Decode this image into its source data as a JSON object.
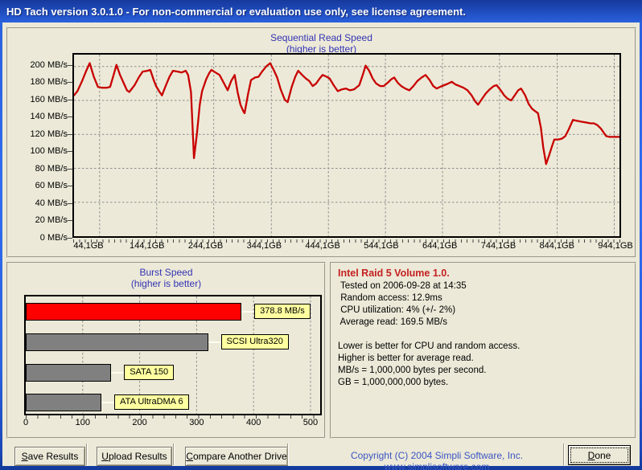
{
  "window": {
    "title": "HD Tach version 3.0.1.0  - For non-commercial or evaluation use only, see license agreement."
  },
  "colors": {
    "window_frame_blue": "#2a62e0",
    "client_beige": "#ece9d8",
    "chart_title_blue": "#3333b3",
    "seq_line_red": "#c80000",
    "burst_bar_red": "#ff0000",
    "burst_bar_gray": "#808080",
    "label_box_yellow": "#ffffa0",
    "drive_name_red": "#c42020",
    "copyright_blue": "#3b55c4"
  },
  "chart_data": [
    {
      "type": "line",
      "title": "Sequential Read Speed",
      "subtitle": "(higher is better)",
      "legend": "read speed (MB/s) vs position (GB)",
      "x_range": [
        14,
        951
      ],
      "y_range": [
        0,
        214
      ],
      "x_ticks": [
        {
          "gb": 44.1,
          "label": "44,1GB"
        },
        {
          "gb": 144.1,
          "label": "144,1GB"
        },
        {
          "gb": 244.1,
          "label": "244,1GB"
        },
        {
          "gb": 344.1,
          "label": "344,1GB"
        },
        {
          "gb": 444.1,
          "label": "444,1GB"
        },
        {
          "gb": 544.1,
          "label": "544,1GB"
        },
        {
          "gb": 644.1,
          "label": "644,1GB"
        },
        {
          "gb": 744.1,
          "label": "744,1GB"
        },
        {
          "gb": 844.1,
          "label": "844,1GB"
        },
        {
          "gb": 944.1,
          "label": "944,1GB"
        }
      ],
      "y_ticks": [
        {
          "v": 200,
          "label": "200 MB/s"
        },
        {
          "v": 180,
          "label": "180 MB/s"
        },
        {
          "v": 160,
          "label": "160 MB/s"
        },
        {
          "v": 140,
          "label": "140 MB/s"
        },
        {
          "v": 120,
          "label": "120 MB/s"
        },
        {
          "v": 100,
          "label": "100 MB/s"
        },
        {
          "v": 80,
          "label": "80 MB/s"
        },
        {
          "v": 60,
          "label": "60 MB/s"
        },
        {
          "v": 40,
          "label": "40 MB/s"
        },
        {
          "v": 20,
          "label": "20 MB/s"
        },
        {
          "v": 0,
          "label": "0 MB/s"
        }
      ],
      "h_gridlines": [
        40,
        80,
        120,
        160,
        200
      ],
      "v_gridlines": [
        58,
        156,
        254,
        353,
        451,
        549,
        647,
        745,
        844,
        942
      ],
      "line_color": "#c80000",
      "points": [
        [
          14,
          166
        ],
        [
          20,
          171
        ],
        [
          28,
          183
        ],
        [
          35,
          195
        ],
        [
          41,
          204
        ],
        [
          48,
          188
        ],
        [
          55,
          176
        ],
        [
          62,
          175
        ],
        [
          70,
          175
        ],
        [
          76,
          176
        ],
        [
          82,
          190
        ],
        [
          87,
          202
        ],
        [
          93,
          190
        ],
        [
          99,
          181
        ],
        [
          105,
          172
        ],
        [
          109,
          170
        ],
        [
          118,
          178
        ],
        [
          126,
          188
        ],
        [
          132,
          194
        ],
        [
          140,
          195
        ],
        [
          145,
          196
        ],
        [
          151,
          184
        ],
        [
          155,
          177
        ],
        [
          161,
          170
        ],
        [
          165,
          166
        ],
        [
          172,
          178
        ],
        [
          178,
          188
        ],
        [
          184,
          195
        ],
        [
          192,
          194
        ],
        [
          199,
          193
        ],
        [
          206,
          195
        ],
        [
          210,
          190
        ],
        [
          215,
          170
        ],
        [
          220,
          92
        ],
        [
          225,
          120
        ],
        [
          230,
          155
        ],
        [
          234,
          171
        ],
        [
          241,
          185
        ],
        [
          246,
          192
        ],
        [
          250,
          196
        ],
        [
          257,
          193
        ],
        [
          264,
          190
        ],
        [
          271,
          181
        ],
        [
          278,
          172
        ],
        [
          284,
          183
        ],
        [
          290,
          190
        ],
        [
          295,
          170
        ],
        [
          300,
          155
        ],
        [
          305,
          147
        ],
        [
          307,
          145
        ],
        [
          313,
          168
        ],
        [
          318,
          184
        ],
        [
          325,
          187
        ],
        [
          331,
          188
        ],
        [
          337,
          194
        ],
        [
          344,
          200
        ],
        [
          351,
          204
        ],
        [
          357,
          196
        ],
        [
          363,
          187
        ],
        [
          369,
          173
        ],
        [
          376,
          161
        ],
        [
          381,
          158
        ],
        [
          388,
          176
        ],
        [
          394,
          188
        ],
        [
          399,
          195
        ],
        [
          406,
          190
        ],
        [
          412,
          186
        ],
        [
          418,
          183
        ],
        [
          424,
          177
        ],
        [
          430,
          180
        ],
        [
          436,
          186
        ],
        [
          441,
          190
        ],
        [
          448,
          188
        ],
        [
          453,
          186
        ],
        [
          460,
          178
        ],
        [
          467,
          171
        ],
        [
          474,
          173
        ],
        [
          481,
          174
        ],
        [
          488,
          172
        ],
        [
          495,
          173
        ],
        [
          504,
          178
        ],
        [
          510,
          190
        ],
        [
          515,
          201
        ],
        [
          521,
          195
        ],
        [
          527,
          186
        ],
        [
          533,
          180
        ],
        [
          540,
          177
        ],
        [
          546,
          177
        ],
        [
          553,
          181
        ],
        [
          559,
          185
        ],
        [
          564,
          187
        ],
        [
          570,
          181
        ],
        [
          576,
          177
        ],
        [
          583,
          174
        ],
        [
          590,
          172
        ],
        [
          597,
          177
        ],
        [
          604,
          183
        ],
        [
          611,
          187
        ],
        [
          618,
          190
        ],
        [
          625,
          184
        ],
        [
          631,
          177
        ],
        [
          637,
          174
        ],
        [
          643,
          176
        ],
        [
          650,
          178
        ],
        [
          657,
          180
        ],
        [
          663,
          182
        ],
        [
          669,
          179
        ],
        [
          676,
          177
        ],
        [
          683,
          175
        ],
        [
          690,
          172
        ],
        [
          697,
          166
        ],
        [
          703,
          159
        ],
        [
          708,
          155
        ],
        [
          714,
          161
        ],
        [
          721,
          168
        ],
        [
          728,
          173
        ],
        [
          735,
          177
        ],
        [
          740,
          178
        ],
        [
          747,
          172
        ],
        [
          753,
          166
        ],
        [
          759,
          162
        ],
        [
          765,
          160
        ],
        [
          771,
          166
        ],
        [
          777,
          172
        ],
        [
          782,
          174
        ],
        [
          789,
          166
        ],
        [
          795,
          156
        ],
        [
          801,
          150
        ],
        [
          807,
          147
        ],
        [
          811,
          145
        ],
        [
          816,
          128
        ],
        [
          820,
          105
        ],
        [
          825,
          85
        ],
        [
          830,
          95
        ],
        [
          835,
          106
        ],
        [
          839,
          114
        ],
        [
          846,
          114
        ],
        [
          852,
          115
        ],
        [
          858,
          118
        ],
        [
          864,
          126
        ],
        [
          871,
          137
        ],
        [
          878,
          136
        ],
        [
          885,
          135
        ],
        [
          894,
          134
        ],
        [
          901,
          133
        ],
        [
          907,
          133
        ],
        [
          913,
          131
        ],
        [
          919,
          127
        ],
        [
          924,
          122
        ],
        [
          928,
          118
        ],
        [
          934,
          117
        ],
        [
          940,
          117
        ],
        [
          947,
          117
        ],
        [
          951,
          117
        ]
      ]
    },
    {
      "type": "bar",
      "title": "Burst Speed",
      "subtitle": "(higher is better)",
      "orientation": "horizontal",
      "x_ticks": [
        "0",
        "100",
        "200",
        "300",
        "400",
        "500"
      ],
      "x_tick_values": [
        0,
        100,
        200,
        300,
        400,
        500
      ],
      "x_range": [
        0,
        517
      ],
      "v_gridlines": [
        100,
        200,
        300,
        400,
        500
      ],
      "bars": [
        {
          "label": "378.8 MB/s",
          "value": 378.8,
          "color": "#ff0000"
        },
        {
          "label": "SCSI Ultra320",
          "value": 320,
          "color": "#808080"
        },
        {
          "label": "SATA 150",
          "value": 150,
          "color": "#808080"
        },
        {
          "label": "ATA UltraDMA 6",
          "value": 133,
          "color": "#808080"
        }
      ],
      "label_bg": "#ffffa0"
    }
  ],
  "info": {
    "title": "Intel Raid 5 Volume 1.0.",
    "lines": [
      " Tested on 2006-09-28 at 14:35",
      " Random access: 12.9ms",
      " CPU utilization: 4% (+/- 2%)",
      " Average read: 169.5 MB/s",
      "",
      "Lower is better for CPU and random access.",
      "Higher is better for average read.",
      "MB/s = 1,000,000 bytes per second.",
      "GB = 1,000,000,000 bytes."
    ]
  },
  "footer": {
    "buttons": [
      {
        "id": "save",
        "label": "Save Results",
        "underline": 0
      },
      {
        "id": "upload",
        "label": "Upload Results",
        "underline": 0
      },
      {
        "id": "compare",
        "label": "Compare Another Drive",
        "underline": 0
      },
      {
        "id": "done",
        "label": "Done",
        "underline": 0
      }
    ],
    "copyright": "Copyright (C) 2004 Simpli Software, Inc. www.simplisoftware.com"
  }
}
